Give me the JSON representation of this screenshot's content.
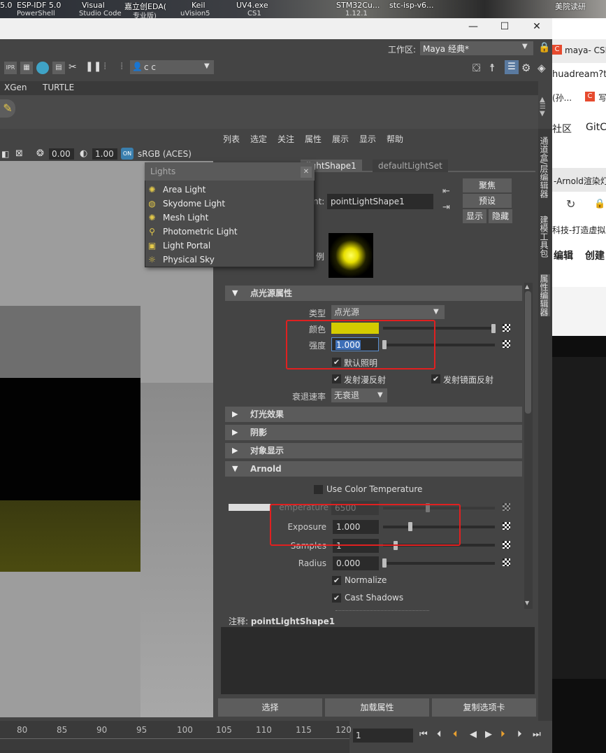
{
  "taskbar": {
    "items": [
      {
        "t1": "5.0",
        "t2": ""
      },
      {
        "t1": "ESP-IDF 5.0",
        "t2": "PowerShell"
      },
      {
        "t1": "Visual",
        "t2": "Studio Code"
      },
      {
        "t1": "嘉立创EDA(",
        "t2": "专业版)"
      },
      {
        "t1": "Keil",
        "t2": "uVision5"
      },
      {
        "t1": "UV4.exe",
        "t2": "CS1"
      },
      {
        "t1": "STM32Cu...",
        "t2": "1.12.1"
      },
      {
        "t1": "stc-isp-v6...",
        "t2": ""
      },
      {
        "t1": "美院读研",
        "t2": ""
      }
    ]
  },
  "window": {
    "minimize": "—",
    "maximize": "☐",
    "close": "✕"
  },
  "menubar": {
    "workspace_label": "工作区:",
    "workspace_value": "Maya 经典*"
  },
  "toolbar": {
    "camera_select": "c c"
  },
  "shelf": {
    "tabs": [
      "XGen",
      "TURTLE"
    ]
  },
  "viewport": {
    "exposure": "0.00",
    "gamma": "1.00",
    "colorspace": "sRGB (ACES)"
  },
  "lights_popup": {
    "title": "Lights",
    "items": [
      "Area Light",
      "Skydome Light",
      "Mesh Light",
      "Photometric Light",
      "Light Portal",
      "Physical Sky"
    ]
  },
  "attr_editor": {
    "menu": [
      "列表",
      "选定",
      "关注",
      "属性",
      "展示",
      "显示",
      "帮助"
    ],
    "tabs": [
      "lightShape1",
      "defaultLightSet"
    ],
    "node_label": "nt:",
    "node_value": "pointLightShape1",
    "side_buttons": {
      "focus": "聚焦",
      "presets": "预设",
      "show": "显示",
      "hide": "隐藏"
    },
    "sample_label": "例",
    "sections": {
      "point_light": "点光源属性",
      "light_effects": "灯光效果",
      "shadows": "阴影",
      "object_display": "对象显示",
      "arnold": "Arnold"
    },
    "type_label": "类型",
    "type_value": "点光源",
    "color_label": "颜色",
    "color_value": "#d4cc00",
    "intensity_label": "强度",
    "intensity_value": "1.000",
    "default_light": "默认照明",
    "emit_diffuse": "发射漫反射",
    "emit_specular": "发射镜面反射",
    "decay_label": "衰退速率",
    "decay_value": "无衰退",
    "use_color_temp": "Use Color Temperature",
    "temperature_label": "emperature",
    "temperature_value": "6500",
    "exposure_label": "Exposure",
    "exposure_value": "1.000",
    "samples_label": "Samples",
    "samples_value": "1",
    "radius_label": "Radius",
    "radius_value": "0.000",
    "normalize": "Normalize",
    "cast_shadows": "Cast Shadows",
    "notes_label": "注释:",
    "notes_node": "pointLightShape1",
    "bottom_buttons": [
      "选择",
      "加载属性",
      "复制选项卡"
    ]
  },
  "vertical_tabs": [
    "通道盒/层编辑器",
    "建模工具包",
    "属性编辑器"
  ],
  "timeline": {
    "ticks": [
      "80",
      "85",
      "90",
      "95",
      "100",
      "105",
      "110",
      "115",
      "120"
    ],
    "current_frame": "1"
  },
  "browser": {
    "tab_title": "maya- CSD",
    "url_part": "huadream?t",
    "item1": "(孙...",
    "item2": "写",
    "item3": "社区",
    "item4": "GitC",
    "item5": "-Arnold渲染灯",
    "item6": "科技-打造虚拟",
    "item7": "编辑",
    "item8": "创建"
  }
}
